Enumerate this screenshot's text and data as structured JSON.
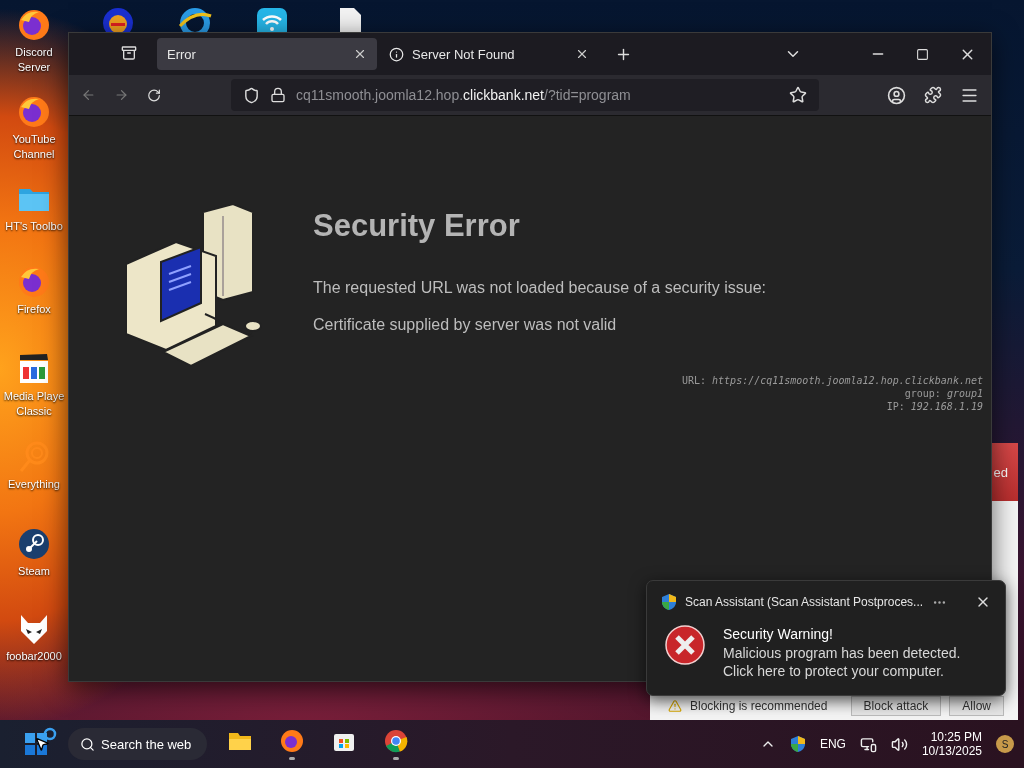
{
  "desktop_icons": [
    {
      "kind": "bubble"
    },
    {
      "kind": "ie"
    },
    {
      "kind": "wifi"
    },
    {
      "kind": "file"
    },
    {
      "kind": "firefox",
      "label": "Discord Server"
    },
    {
      "kind": "firefox",
      "label": "YouTube Channel"
    },
    {
      "kind": "folder",
      "label": "HT's Toolbo"
    },
    {
      "kind": "firefox",
      "label": "Firefox"
    },
    {
      "kind": "player",
      "label": "Media Playe Classic"
    },
    {
      "kind": "ring",
      "label": "Everything"
    },
    {
      "kind": "steam",
      "label": "Steam"
    },
    {
      "kind": "mask",
      "label": "foobar2000"
    }
  ],
  "background_window": {
    "header_text": "ed",
    "warning": "Blocking is recommended",
    "buttons": [
      "Block attack",
      "Allow"
    ]
  },
  "browser": {
    "tabs": [
      {
        "title": "Error",
        "kind": "plain",
        "selected": true
      },
      {
        "title": "Server Not Found",
        "kind": "info",
        "selected": false
      }
    ],
    "address": {
      "before": "cq11smooth.joomla12.hop.",
      "domain": "clickbank.net",
      "after": "/?tid=program"
    },
    "page": {
      "title": "Security Error",
      "lines": [
        "The requested URL was not loaded because of a security issue:",
        "Certificate supplied by server was not valid"
      ],
      "details": [
        "URL: *https://cq11smooth.joomla12.hop.clickbank.net*",
        "group: *group1*",
        "IP: *192.168.1.19*"
      ]
    }
  },
  "notification": {
    "app": "Scan Assistant (Scan Assistant Postproces...",
    "title": "Security Warning!",
    "lines": [
      "Malicious program has been detected.",
      "Click here to protect your computer."
    ]
  },
  "taskbar": {
    "search": "Search the web",
    "apps": [
      {
        "kind": "explorer",
        "running": false
      },
      {
        "kind": "firefox",
        "running": true
      },
      {
        "kind": "store",
        "running": false
      },
      {
        "kind": "chrome",
        "running": true
      }
    ],
    "language": "ENG",
    "time": "10:25 PM",
    "date": "10/13/2025",
    "avatar": "S"
  }
}
